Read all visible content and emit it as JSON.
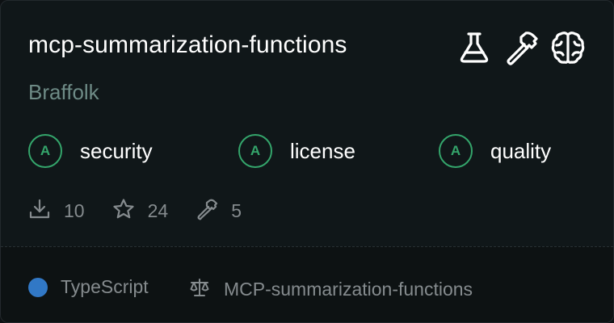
{
  "card": {
    "title": "mcp-summarization-functions",
    "author": "Braffolk",
    "feature_icons": [
      "flask-icon",
      "hammer-icon",
      "brain-icon"
    ],
    "scores": [
      {
        "grade": "A",
        "label": "security"
      },
      {
        "grade": "A",
        "label": "license"
      },
      {
        "grade": "A",
        "label": "quality"
      }
    ],
    "stats": {
      "downloads": "10",
      "stars": "24",
      "tools": "5"
    },
    "footer": {
      "language": "TypeScript",
      "language_color": "#3178c6",
      "license": "MCP-summarization-functions"
    },
    "colors": {
      "grade": "#34a56b",
      "author": "#6e8b86"
    }
  }
}
